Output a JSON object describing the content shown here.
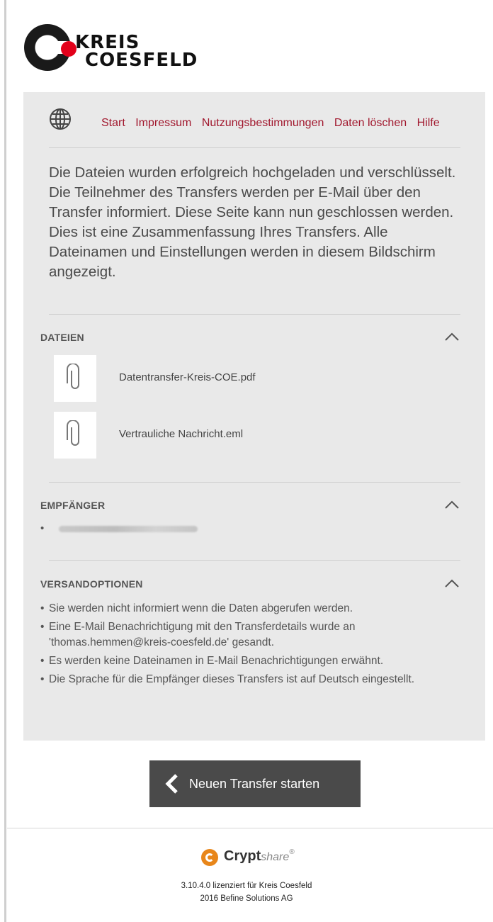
{
  "brand": {
    "line1": "KREIS",
    "line2": "COESFELD",
    "logo_colors": {
      "mark": "#1a1a1a",
      "dot": "#e2001a"
    }
  },
  "nav": {
    "globe_icon": "globe-icon",
    "links": [
      "Start",
      "Impressum",
      "Nutzungsbestimmungen",
      "Daten löschen",
      "Hilfe"
    ],
    "link_color": "#a1172d"
  },
  "intro": "Die Dateien wurden erfolgreich hochgeladen und verschlüsselt. Die Teilnehmer des Transfers werden per E-Mail über den Transfer informiert. Diese Seite kann nun geschlossen werden. Dies ist eine Zusammenfassung Ihres Transfers. Alle Dateinamen und Einstellungen werden in diesem Bildschirm angezeigt.",
  "files": {
    "title": "DATEIEN",
    "items": [
      "Datentransfer-Kreis-COE.pdf",
      "Vertrauliche Nachricht.eml"
    ]
  },
  "recipients": {
    "title": "EMPFÄNGER",
    "bullet": "•"
  },
  "options": {
    "title": "VERSANDOPTIONEN",
    "items": [
      "Sie werden nicht informiert wenn die Daten abgerufen werden.",
      "Eine E-Mail Benachrichtigung mit den Transferdetails wurde an 'thomas.hemmen@kreis-coesfeld.de' gesandt.",
      "Es werden keine Dateinamen in E-Mail Benachrichtigungen erwähnt.",
      "Die Sprache für die Empfänger dieses Transfers ist auf Deutsch eingestellt."
    ]
  },
  "action": {
    "label": "Neuen Transfer starten"
  },
  "footer": {
    "brand_bold": "Crypt",
    "brand_light": "share",
    "brand_mark": "®",
    "license": "3.10.4.0 lizenziert für Kreis Coesfeld",
    "copyright": "2016 Befine Solutions AG",
    "accent": "#e8861a"
  }
}
